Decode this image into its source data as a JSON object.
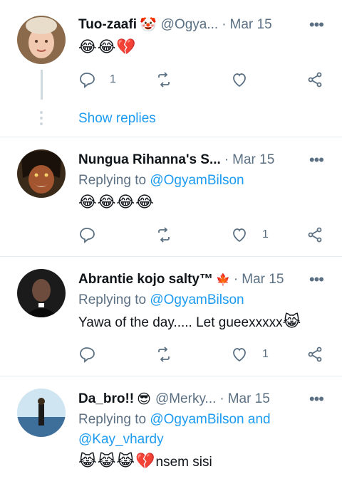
{
  "tweets": [
    {
      "name": "Tuo-zaafi",
      "name_emoji": "🤡",
      "handle": "@Ogya...",
      "date": "Mar 15",
      "replying_prefix": "",
      "replying_to": "",
      "text": "",
      "emoji": "😂😂💔",
      "reply_count": "1",
      "retweet_count": "",
      "like_count": "",
      "show_replies": "Show replies"
    },
    {
      "name": "Nungua Rihanna's S...",
      "date": "Mar 15",
      "replying_prefix": "Replying to",
      "replying_to": "@OgyamBilson",
      "emoji": "😂😂😂😂",
      "reply_count": "",
      "retweet_count": "",
      "like_count": "1"
    },
    {
      "name": "Abrantie kojo salty™",
      "name_emoji": "🇨🇦",
      "date": "Mar 15",
      "replying_prefix": "Replying to",
      "replying_to": "@OgyamBilson",
      "text": "Yawa of the day..... Let gueexxxxx",
      "text_emoji": "😹",
      "reply_count": "",
      "retweet_count": "",
      "like_count": "1"
    },
    {
      "name": "Da_bro!!",
      "name_emoji": "😎",
      "handle": "@Merky...",
      "date": "Mar 15",
      "replying_prefix": "Replying to",
      "replying_to": "@OgyamBilson and",
      "replying_to_2": "@Kay_vhardy",
      "emoji": "😹😹😹💔",
      "text": "nsem sisi"
    }
  ],
  "common": {
    "separator": "·",
    "more": "•••"
  }
}
